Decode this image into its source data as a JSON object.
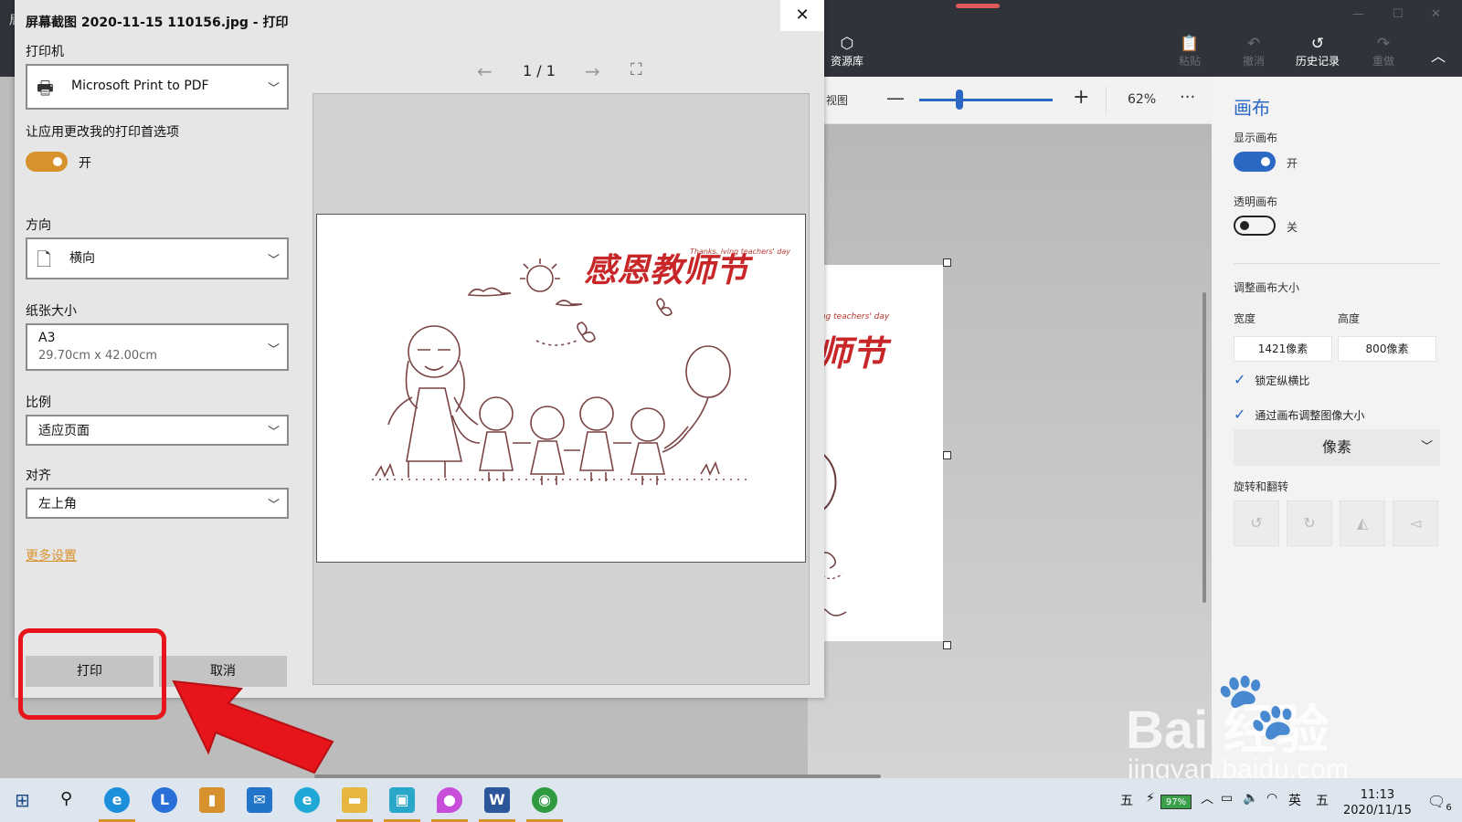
{
  "app": {
    "title_letter": "局",
    "tools": [
      {
        "label": "资源库",
        "icon": "cube-icon"
      },
      {
        "label": "粘贴",
        "icon": "paste-icon"
      },
      {
        "label": "撤消",
        "icon": "undo-icon"
      },
      {
        "label": "历史记录",
        "icon": "history-icon"
      },
      {
        "label": "重做",
        "icon": "redo-icon"
      }
    ],
    "view": {
      "label": "视图",
      "zoom": "62%",
      "more": "···",
      "zoom_level": 0.29
    },
    "canvas_preview": {
      "subtitle": "ving teachers' day",
      "text": "师节"
    }
  },
  "panel": {
    "title": "画布",
    "show_canvas": {
      "label": "显示画布",
      "state": "开",
      "on": true
    },
    "transparent_canvas": {
      "label": "透明画布",
      "state": "关",
      "on": false
    },
    "resize_title": "调整画布大小",
    "width_label": "宽度",
    "height_label": "高度",
    "width_value": "1421像素",
    "height_value": "800像素",
    "lock_aspect": {
      "label": "锁定纵横比",
      "checked": true
    },
    "resize_image": {
      "label": "通过画布调整图像大小",
      "checked": true
    },
    "units": "像素",
    "rotate_title": "旋转和翻转"
  },
  "dialog": {
    "title": "屏幕截图 2020-11-15 110156.jpg - 打印",
    "printer_label": "打印机",
    "printer_value": "Microsoft Print to PDF",
    "pref_label": "让应用更改我的打印首选项",
    "pref_state": "开",
    "pref_on": true,
    "orientation_label": "方向",
    "orientation_value": "横向",
    "paper_label": "纸张大小",
    "paper_value": "A3",
    "paper_size": "29.70cm x 42.00cm",
    "scale_label": "比例",
    "scale_value": "适应页面",
    "align_label": "对齐",
    "align_value": "左上角",
    "more_settings": "更多设置",
    "print_button": "打印",
    "cancel_button": "取消",
    "page_indicator": "1 / 1",
    "preview_en": "Thanks. iving teachers' day",
    "preview_cn": "感恩教师节"
  },
  "watermark": {
    "logo": "Bai  经验",
    "url": "jingyan.baidu.com"
  },
  "taskbar": {
    "ime_left": "五",
    "battery": "97%",
    "lang": "英",
    "ime_right": "五",
    "time": "11:13",
    "date": "2020/11/15",
    "notifications": "6"
  },
  "colors": {
    "accent_orange": "#d8922d",
    "accent_blue": "#2b68c4",
    "highlight_red": "#e8141b",
    "title_red": "#c8272a"
  }
}
